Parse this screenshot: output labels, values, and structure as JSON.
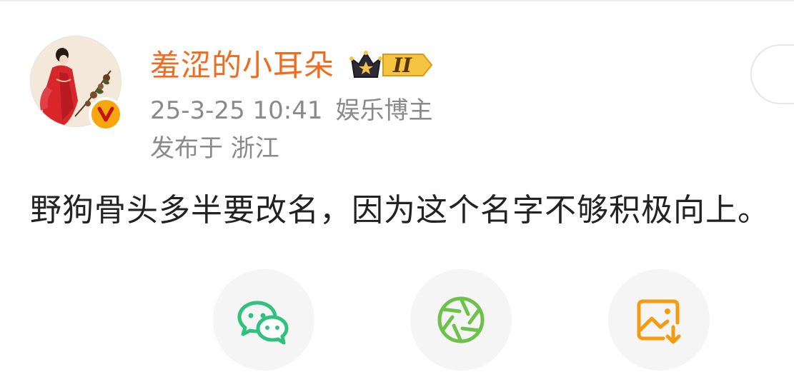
{
  "post": {
    "author": {
      "username": "羞涩的小耳朵",
      "level_badge": "II",
      "verified_mark": "V"
    },
    "timestamp": "25-3-25 10:41",
    "author_category": "娱乐博主",
    "location_line": "发布于 浙江",
    "content": "野狗骨头多半要改名，因为这个名字不够积极向上。"
  },
  "icons": {
    "avatar": "avatar-image",
    "verified": "verified-v-icon",
    "crown": "crown-level-icon",
    "wechat": "wechat-icon",
    "moments": "moments-icon",
    "save_image": "save-image-icon"
  },
  "colors": {
    "username": "#f26a1c",
    "meta_text": "#8a8a8a",
    "body_text": "#222222",
    "verified_badge": "#f7a60d",
    "wechat_green": "#2ec27e",
    "moments_green": "#6cc24a",
    "save_orange": "#f39c12",
    "share_bg": "#f5f5f5"
  }
}
